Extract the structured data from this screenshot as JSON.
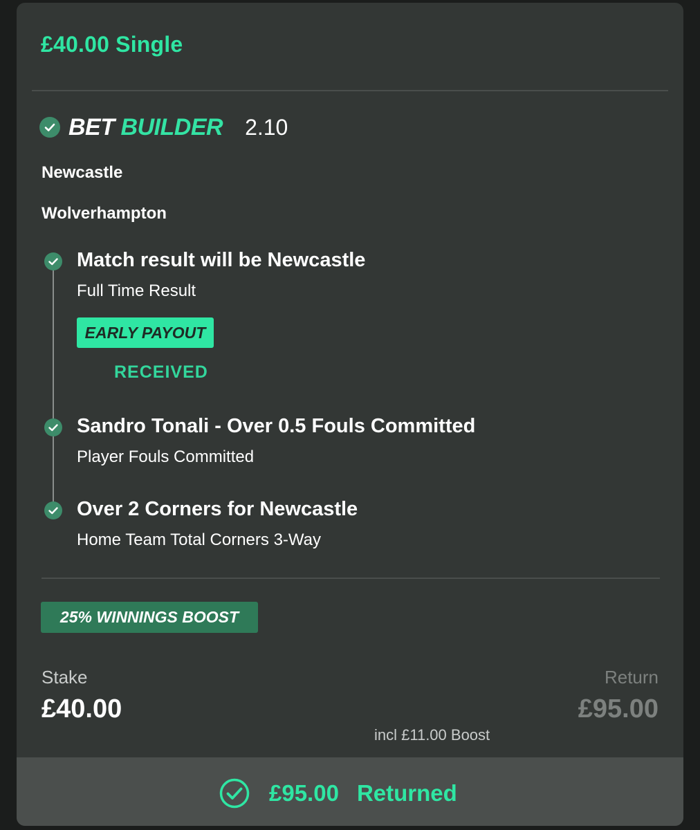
{
  "header": {
    "title": "£40.00 Single"
  },
  "bet_builder": {
    "logo_word1": "BET",
    "logo_word2": "BUILDER",
    "odds": "2.10",
    "status_icon": "check-circle-icon"
  },
  "match": {
    "home_team": "Newcastle",
    "away_team": "Wolverhampton"
  },
  "legs": [
    {
      "title": "Match result will be Newcastle",
      "subtitle": "Full Time Result",
      "badge": "EARLY PAYOUT",
      "badge_status": "RECEIVED",
      "status_icon": "check-circle-icon"
    },
    {
      "title": "Sandro Tonali - Over 0.5 Fouls Committed",
      "subtitle": "Player Fouls Committed",
      "status_icon": "check-circle-icon"
    },
    {
      "title": "Over 2 Corners for Newcastle",
      "subtitle": "Home Team Total Corners 3-Way",
      "status_icon": "check-circle-icon"
    }
  ],
  "boost": {
    "label": "25% WINNINGS BOOST"
  },
  "summary": {
    "stake_label": "Stake",
    "stake_value": "£40.00",
    "return_label": "Return",
    "return_value": "£95.00",
    "boost_note": "incl £11.00 Boost"
  },
  "footer": {
    "amount": "£95.00",
    "status": "Returned",
    "icon": "check-circle-outline-icon"
  },
  "colors": {
    "accent": "#2fe6a3",
    "check_green": "#3d8c6a",
    "boost_green": "#2f7a58",
    "card_bg": "#333735",
    "footer_bg": "#4b4f4d"
  }
}
